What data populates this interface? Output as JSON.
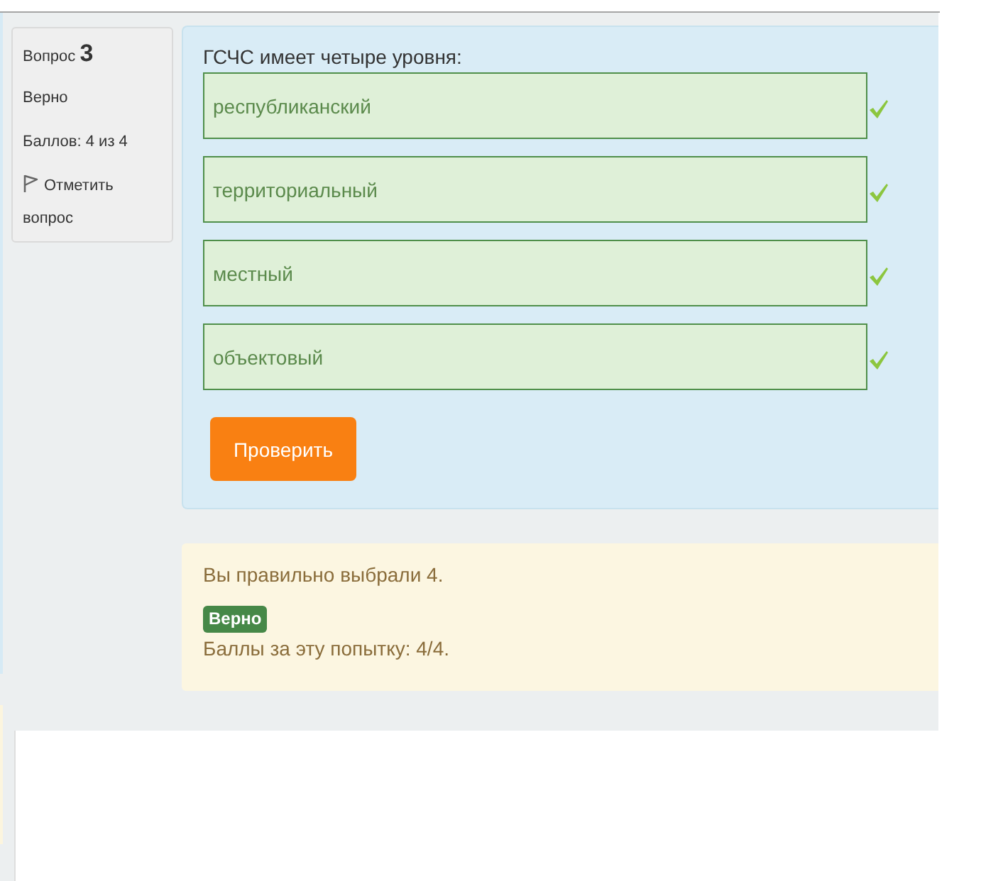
{
  "info": {
    "heading": "Вопрос **3**",
    "status": "Верно",
    "grade": "Баллов: 4 из 4",
    "flag_link": "Отметить вопрос",
    "flagged": false
  },
  "question": {
    "text": "ГСЧС имеет четыре уровня:",
    "answers": [
      {
        "value": "республиканский",
        "correct": true
      },
      {
        "value": "территориальный",
        "correct": true
      },
      {
        "value": "местный",
        "correct": true
      },
      {
        "value": "объектовый",
        "correct": true
      }
    ],
    "button": "Проверить"
  },
  "feedback": {
    "message": "Вы правильно выбрали 4.",
    "badge": "Верно",
    "score": "Баллы за эту попытку: 4/4."
  }
}
